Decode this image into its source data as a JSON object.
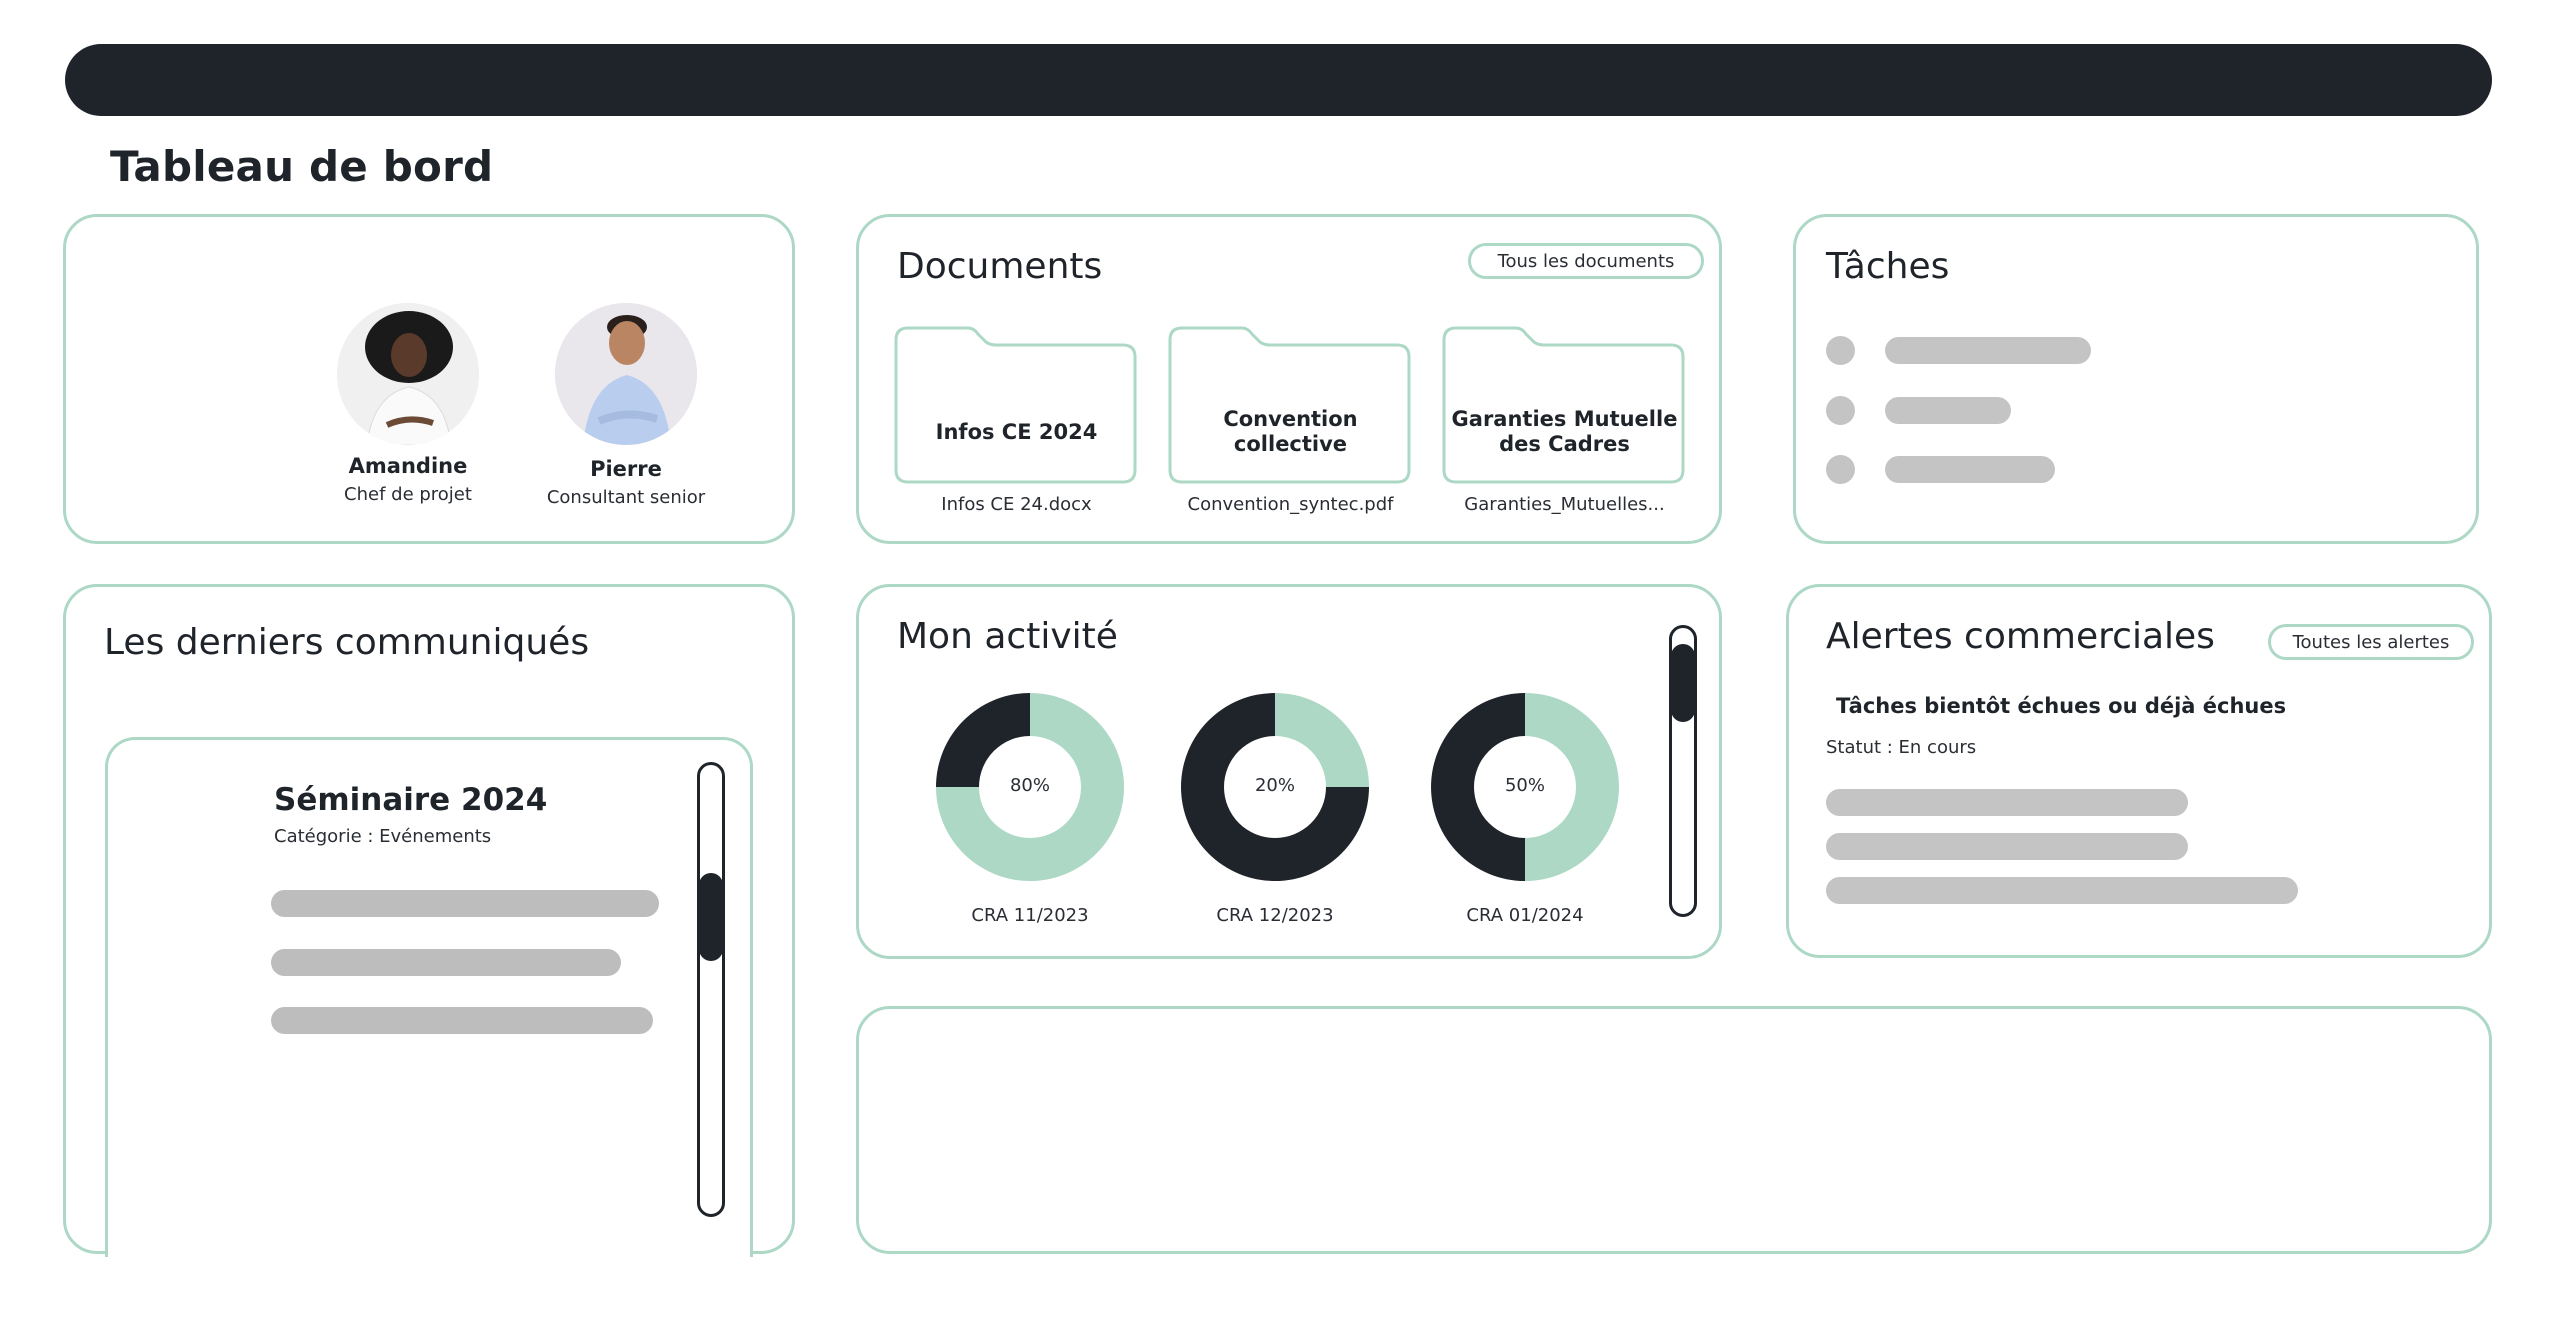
{
  "page": {
    "title": "Tableau de bord"
  },
  "colors": {
    "accent": "#acd8c5",
    "dark": "#1f232a",
    "skeleton": "#c4c4c4"
  },
  "team": {
    "members": [
      {
        "name": "Amandine",
        "role": "Chef de projet",
        "avatar": "avatar-photo-woman"
      },
      {
        "name": "Pierre",
        "role": "Consultant senior",
        "avatar": "avatar-photo-man"
      }
    ]
  },
  "documents": {
    "title": "Documents",
    "all_button": "Tous les documents",
    "folders": [
      {
        "name": "Infos CE 2024",
        "file": "Infos CE 24.docx"
      },
      {
        "name": "Convention collective",
        "file": "Convention_syntec.pdf"
      },
      {
        "name": "Garanties Mutuelle des Cadres",
        "file": "Garanties_Mutuelles..."
      }
    ]
  },
  "tasks": {
    "title": "Tâches",
    "items": [
      {
        "placeholder": true
      },
      {
        "placeholder": true
      },
      {
        "placeholder": true
      }
    ]
  },
  "news": {
    "title": "Les derniers communiqués",
    "item": {
      "title": "Séminaire 2024",
      "category": "Catégorie : Evénements"
    }
  },
  "activity": {
    "title": "Mon activité",
    "chart_data": {
      "type": "pie",
      "subtype": "donut",
      "series": [
        {
          "label": "CRA 11/2023",
          "center_text": "80%",
          "value": 80,
          "filled_fraction_shown": 0.75
        },
        {
          "label": "CRA 12/2023",
          "center_text": "20%",
          "value": 20,
          "filled_fraction_shown": 0.25
        },
        {
          "label": "CRA 01/2024",
          "center_text": "50%",
          "value": 50,
          "filled_fraction_shown": 0.5
        }
      ],
      "colors": {
        "filled": "#acd8c5",
        "remaining": "#1f232a"
      }
    }
  },
  "alerts": {
    "title": "Alertes commerciales",
    "all_button": "Toutes les alertes",
    "subtitle": "Tâches bientôt échues ou déjà échues",
    "status": "Statut : En cours"
  }
}
